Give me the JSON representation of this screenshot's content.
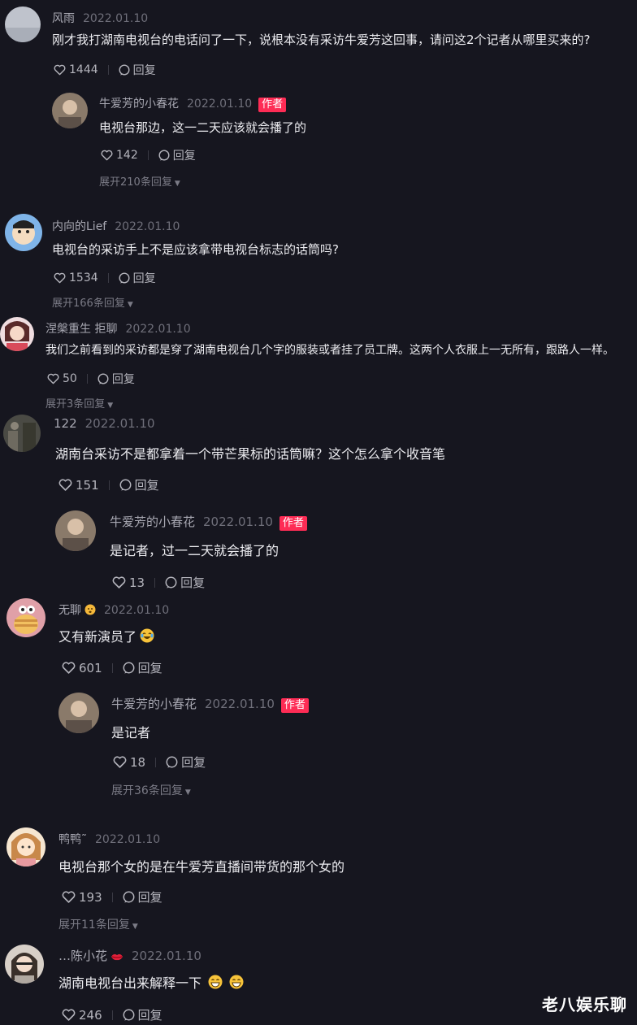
{
  "comments": [
    {
      "name": "风雨",
      "date": "2022.01.10",
      "text": "刚才我打湖南电视台的电话问了一下，说根本没有采访牛爱芳这回事，请问这2个记者从哪里买来的?",
      "likes": "1444",
      "reply_label": "回复",
      "avatar_color": "#bfc3cc",
      "reply": {
        "name": "牛爱芳的小春花",
        "date": "2022.01.10",
        "tag": "作者",
        "text": "电视台那边，这一二天应该就会播了的",
        "likes": "142",
        "reply_label": "回复",
        "expand": "展开210条回复"
      }
    },
    {
      "name": "内向的Lief",
      "date": "2022.01.10",
      "text": "电视台的采访手上不是应该拿带电视台标志的话筒吗?",
      "likes": "1534",
      "reply_label": "回复",
      "avatar_color": "#7fb4e8",
      "expand": "展开166条回复"
    },
    {
      "name": "涅槃重生 拒聊",
      "date": "2022.01.10",
      "text": "我们之前看到的采访都是穿了湖南电视台几个字的服装或者挂了员工牌。这两个人衣服上一无所有，跟路人一样。",
      "likes": "50",
      "reply_label": "回复",
      "avatar_color": "#e8b4b8",
      "expand": "展开3条回复"
    },
    {
      "name": "122",
      "date": "2022.01.10",
      "text": "湖南台采访不是都拿着一个带芒果标的话筒嘛？这个怎么拿个收音笔",
      "likes": "151",
      "reply_label": "回复",
      "avatar_color": "#5a5a55",
      "reply": {
        "name": "牛爱芳的小春花",
        "date": "2022.01.10",
        "tag": "作者",
        "text": "是记者，过一二天就会播了的",
        "likes": "13",
        "reply_label": "回复"
      }
    },
    {
      "name": "无聊",
      "date": "2022.01.10",
      "text": "又有新演员了",
      "likes": "601",
      "reply_label": "回复",
      "avatar_color": "#e8c9a8",
      "reply": {
        "name": "牛爱芳的小春花",
        "date": "2022.01.10",
        "tag": "作者",
        "text": "是记者",
        "likes": "18",
        "reply_label": "回复",
        "expand": "展开36条回复"
      }
    },
    {
      "name": "鸭鸭˜",
      "date": "2022.01.10",
      "text": "电视台那个女的是在牛爱芳直播间带货的那个女的",
      "likes": "193",
      "reply_label": "回复",
      "avatar_color": "#f2d0a0",
      "expand": "展开11条回复"
    },
    {
      "name": "…陈小花",
      "date": "2022.01.10",
      "text": "湖南电视台出来解释一下",
      "likes": "246",
      "reply_label": "回复",
      "avatar_color": "#d8d0c8"
    }
  ],
  "watermark": "老八娱乐聊"
}
